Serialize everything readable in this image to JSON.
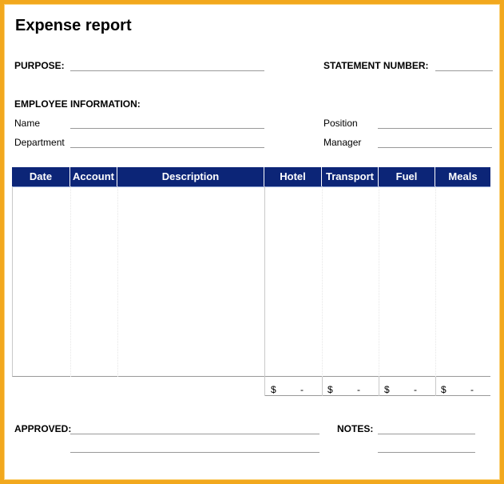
{
  "document": {
    "title": "Expense report",
    "purpose_label": "PURPOSE:",
    "statement_number_label": "STATEMENT NUMBER:",
    "employee_info_label": "EMPLOYEE INFORMATION:",
    "name_label": "Name",
    "department_label": "Department",
    "position_label": "Position",
    "manager_label": "Manager",
    "approved_label": "APPROVED:",
    "notes_label": "NOTES:"
  },
  "table": {
    "headers": [
      "Date",
      "Account",
      "Description",
      "Hotel",
      "Transport",
      "Fuel",
      "Meals"
    ],
    "totals": [
      {
        "currency": "$",
        "value": "-"
      },
      {
        "currency": "$",
        "value": "-"
      },
      {
        "currency": "$",
        "value": "-"
      },
      {
        "currency": "$",
        "value": "-"
      }
    ]
  },
  "colors": {
    "frame": "#f2a81d",
    "header_bg": "#0c2577",
    "header_text": "#ffffff"
  }
}
